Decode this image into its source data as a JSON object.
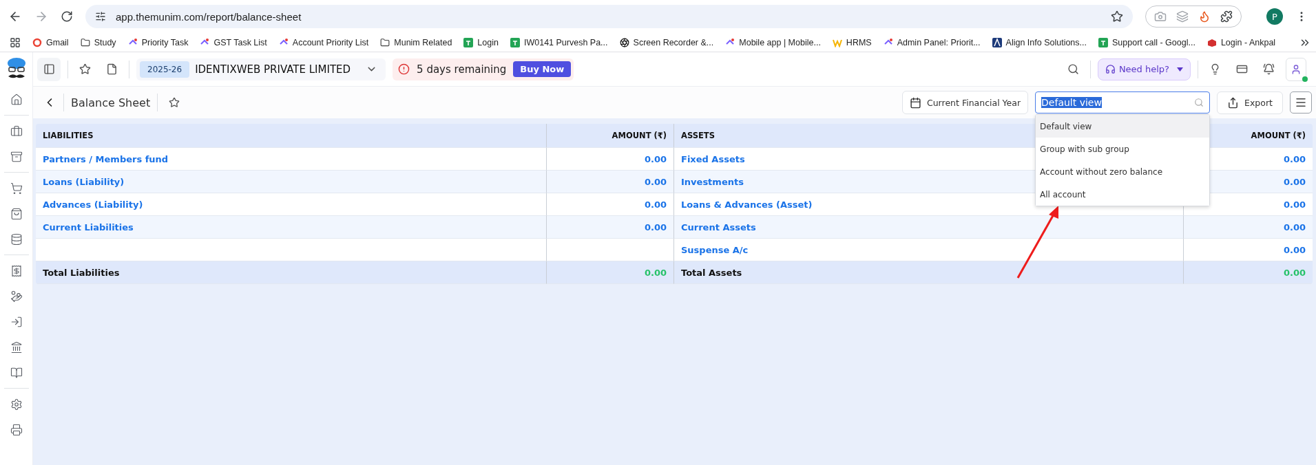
{
  "browser": {
    "url": "app.themunim.com/report/balance-sheet",
    "profile": "P",
    "bookmarks": [
      "Gmail",
      "Study",
      "Priority Task",
      "GST Task List",
      "Account Priority List",
      "Munim Related",
      "Login",
      "IW0141 Purvesh Pa...",
      "Screen Recorder &...",
      "Mobile app | Mobile...",
      "HRMS",
      "Admin Panel: Priorit...",
      "Align Info Solutions...",
      "Support call - Googl...",
      "Login - Ankpal"
    ]
  },
  "header": {
    "year": "2025-26",
    "company": "IDENTIXWEB PRIVATE LIMITED",
    "trial_notice": "5 days remaining",
    "buy_button": "Buy Now",
    "help_button": "Need help?"
  },
  "page": {
    "title": "Balance Sheet",
    "period_button": "Current Financial Year",
    "view_search": {
      "value": "Default view"
    },
    "export_button": "Export"
  },
  "view_menu": [
    {
      "label": "Default view",
      "selected": true
    },
    {
      "label": "Group with sub group",
      "selected": false
    },
    {
      "label": "Account without zero balance",
      "selected": false
    },
    {
      "label": "All account",
      "selected": false
    }
  ],
  "table": {
    "columns": [
      "LIABILITIES",
      "AMOUNT (₹)",
      "ASSETS",
      "AMOUNT (₹)"
    ],
    "rows": [
      {
        "liability": "Partners / Members fund",
        "liability_amount": "0.00",
        "asset": "Fixed Assets",
        "asset_amount": "0.00"
      },
      {
        "liability": "Loans (Liability)",
        "liability_amount": "0.00",
        "asset": "Investments",
        "asset_amount": "0.00"
      },
      {
        "liability": "Advances (Liability)",
        "liability_amount": "0.00",
        "asset": "Loans & Advances (Asset)",
        "asset_amount": "0.00"
      },
      {
        "liability": "Current Liabilities",
        "liability_amount": "0.00",
        "asset": "Current Assets",
        "asset_amount": "0.00"
      },
      {
        "asset": "Suspense A/c",
        "asset_amount": "0.00"
      }
    ],
    "totals": {
      "liability_label": "Total Liabilities",
      "liability_amount": "0.00",
      "asset_label": "Total Assets",
      "asset_amount": "0.00"
    }
  }
}
